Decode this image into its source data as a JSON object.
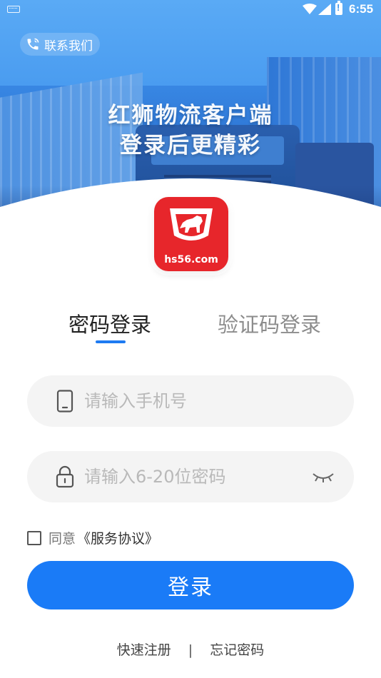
{
  "status_bar": {
    "time": "6:55"
  },
  "header": {
    "contact_label": "联系我们",
    "slogan_line1": "红狮物流客户端",
    "slogan_line2": "登录后更精彩",
    "logo_text": "hs56.com"
  },
  "tabs": [
    {
      "label": "密码登录",
      "active": true
    },
    {
      "label": "验证码登录",
      "active": false
    }
  ],
  "form": {
    "phone_placeholder": "请输入手机号",
    "phone_value": "",
    "password_placeholder": "请输入6-20位密码",
    "password_value": "",
    "agree_prefix": "同意",
    "agree_link": "《服务协议》",
    "agree_checked": false,
    "login_label": "登录"
  },
  "footer": {
    "register_label": "快速注册",
    "separator": "|",
    "forgot_label": "忘记密码"
  },
  "colors": {
    "primary": "#1a7bf7",
    "logo_red": "#e7262b",
    "input_bg": "#f4f4f4"
  },
  "icons": [
    "keyboard-icon",
    "wifi-icon",
    "signal-icon",
    "battery-icon",
    "phone-call-icon",
    "lion-logo-icon",
    "mobile-phone-icon",
    "lock-icon",
    "eye-closed-icon"
  ]
}
